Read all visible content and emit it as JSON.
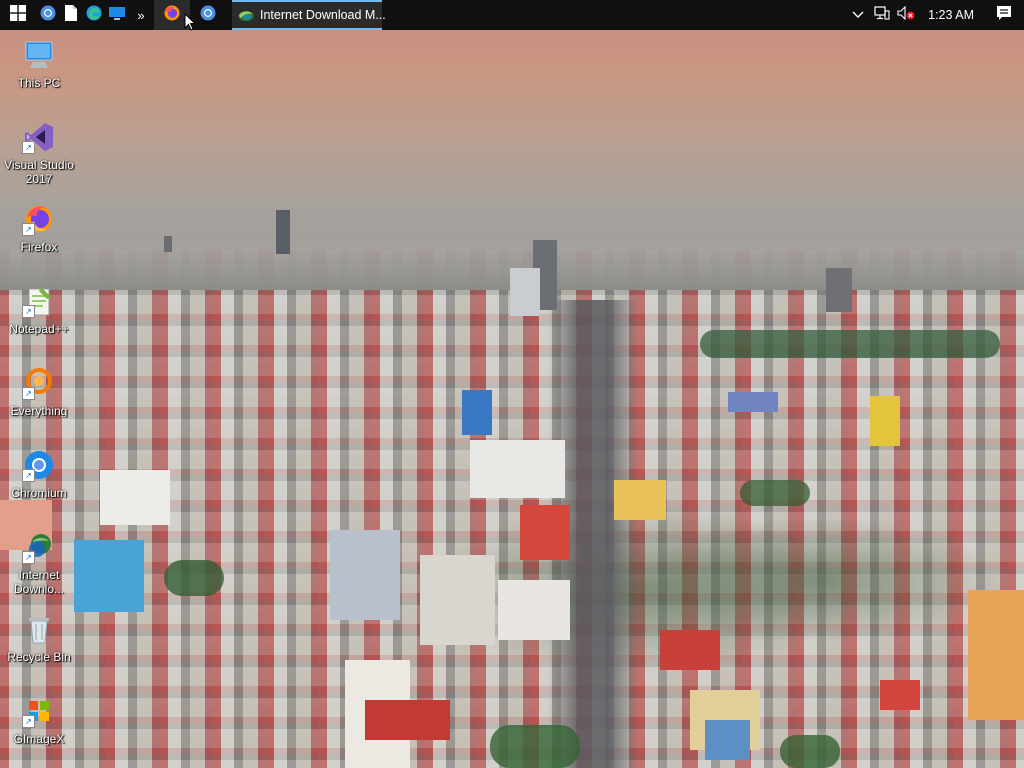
{
  "taskbar": {
    "start_icon": "windows-start-icon",
    "pinned": [
      {
        "name": "chromium-taskbar-icon"
      },
      {
        "name": "file-taskbar-icon"
      },
      {
        "name": "edge-taskbar-icon"
      },
      {
        "name": "remote-desktop-taskbar-icon"
      }
    ],
    "overflow_label": "»",
    "active_apps": [
      {
        "name": "firefox-taskbar-icon"
      },
      {
        "name": "chromium-taskbar-icon-2"
      }
    ],
    "task_button": {
      "label": "Internet Download M...",
      "icon": "idm-icon"
    },
    "tray": {
      "chevron_icon": "chevron-up-icon",
      "network_icon": "network-icon",
      "volume_icon": "volume-muted-icon",
      "clock": "1:23 AM",
      "notification_icon": "action-center-icon"
    }
  },
  "desktop": {
    "icons": [
      {
        "id": "this-pc",
        "label": "This PC",
        "icon": "computer-icon"
      },
      {
        "id": "visual-studio",
        "label": "Visual Studio 2017",
        "icon": "visual-studio-icon"
      },
      {
        "id": "firefox",
        "label": "Firefox",
        "icon": "firefox-icon"
      },
      {
        "id": "notepadpp",
        "label": "Notepad++",
        "icon": "notepadpp-icon"
      },
      {
        "id": "everything",
        "label": "Everything",
        "icon": "everything-search-icon"
      },
      {
        "id": "chromium",
        "label": "Chromium",
        "icon": "chromium-icon"
      },
      {
        "id": "idm",
        "label": "Internet Downlo...",
        "icon": "internet-download-manager-icon"
      },
      {
        "id": "recycle-bin",
        "label": "Recycle Bin",
        "icon": "recycle-bin-icon"
      },
      {
        "id": "gimagex",
        "label": "GImageX",
        "icon": "gimagex-icon"
      }
    ]
  },
  "colors": {
    "taskbar_bg": "#101010",
    "task_active_bg": "#2b2b2b",
    "task_accent": "#76b9ed"
  }
}
